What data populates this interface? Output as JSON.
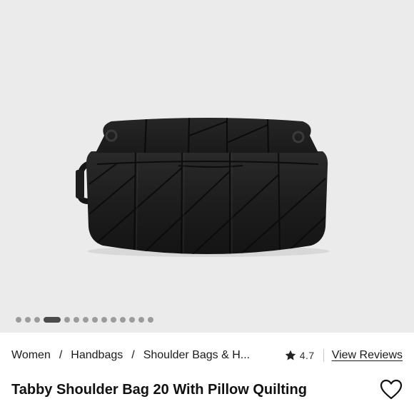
{
  "gallery": {
    "image_alt": "Tabby Shoulder Bag 20 With Pillow Quilting",
    "dot_count": 14,
    "active_dot": 3
  },
  "breadcrumb": {
    "items": [
      {
        "label": "Women"
      },
      {
        "label": "Handbags"
      },
      {
        "label": "Shoulder Bags & H..."
      }
    ],
    "separator": "/"
  },
  "rating": {
    "value": "4.7",
    "reviews_link": "View Reviews",
    "icon": "star-icon"
  },
  "product": {
    "title": "Tabby Shoulder Bag 20 With Pillow Quilting",
    "wishlist_icon": "heart-icon"
  },
  "colors": {
    "gallery_bg": "#ebebeb",
    "bag": "#1b1b1b",
    "text": "#111111"
  }
}
